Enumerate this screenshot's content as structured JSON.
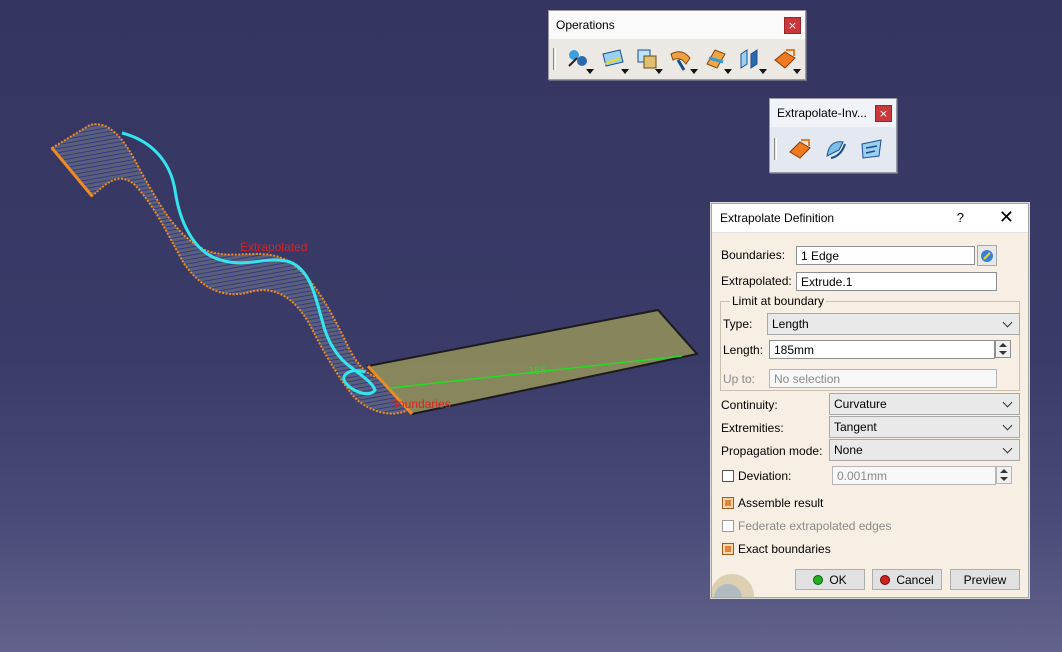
{
  "toolbar_operations": {
    "title": "Operations",
    "close": "×",
    "icons": [
      "join-healing-icon",
      "boundary-icon",
      "untrim-icon",
      "fillet-icon",
      "split-trim-icon",
      "translate-icon",
      "extrapolate-icon"
    ]
  },
  "toolbar_extrapolate": {
    "title": "Extrapolate-Inv...",
    "close": "×",
    "icons": [
      "extrapolate-icon",
      "invert-orientation-icon",
      "near-icon"
    ]
  },
  "viewport": {
    "label_extrapolated": "Extrapolated",
    "label_boundaries": "Boundaries",
    "dimension": "185"
  },
  "dialog": {
    "title": "Extrapolate Definition",
    "help": "?",
    "close": "✕",
    "boundaries_label": "Boundaries:",
    "boundaries_value": "1 Edge",
    "extrapolated_label": "Extrapolated:",
    "extrapolated_value": "Extrude.1",
    "limit_group": "Limit at boundary",
    "type_label": "Type:",
    "type_value": "Length",
    "length_label": "Length:",
    "length_value": "185mm",
    "upto_label": "Up to:",
    "upto_value": "No selection",
    "continuity_label": "Continuity:",
    "continuity_value": "Curvature",
    "extremities_label": "Extremities:",
    "extremities_value": "Tangent",
    "propagation_label": "Propagation mode:",
    "propagation_value": "None",
    "deviation_label": "Deviation:",
    "deviation_value": "0.001mm",
    "assemble_label": "Assemble result",
    "assemble_checked": true,
    "federate_label": "Federate extrapolated edges",
    "federate_checked": false,
    "exact_label": "Exact boundaries",
    "exact_checked": true,
    "ok_label": "OK",
    "cancel_label": "Cancel",
    "preview_label": "Preview"
  },
  "colors": {
    "background": "#3a3b68",
    "surface_fill": "#8c8a5c",
    "curve": "#33e6ee",
    "edge_highlight": "#ee8a22",
    "dimension": "#22dd22",
    "label_red": "#e02020"
  }
}
